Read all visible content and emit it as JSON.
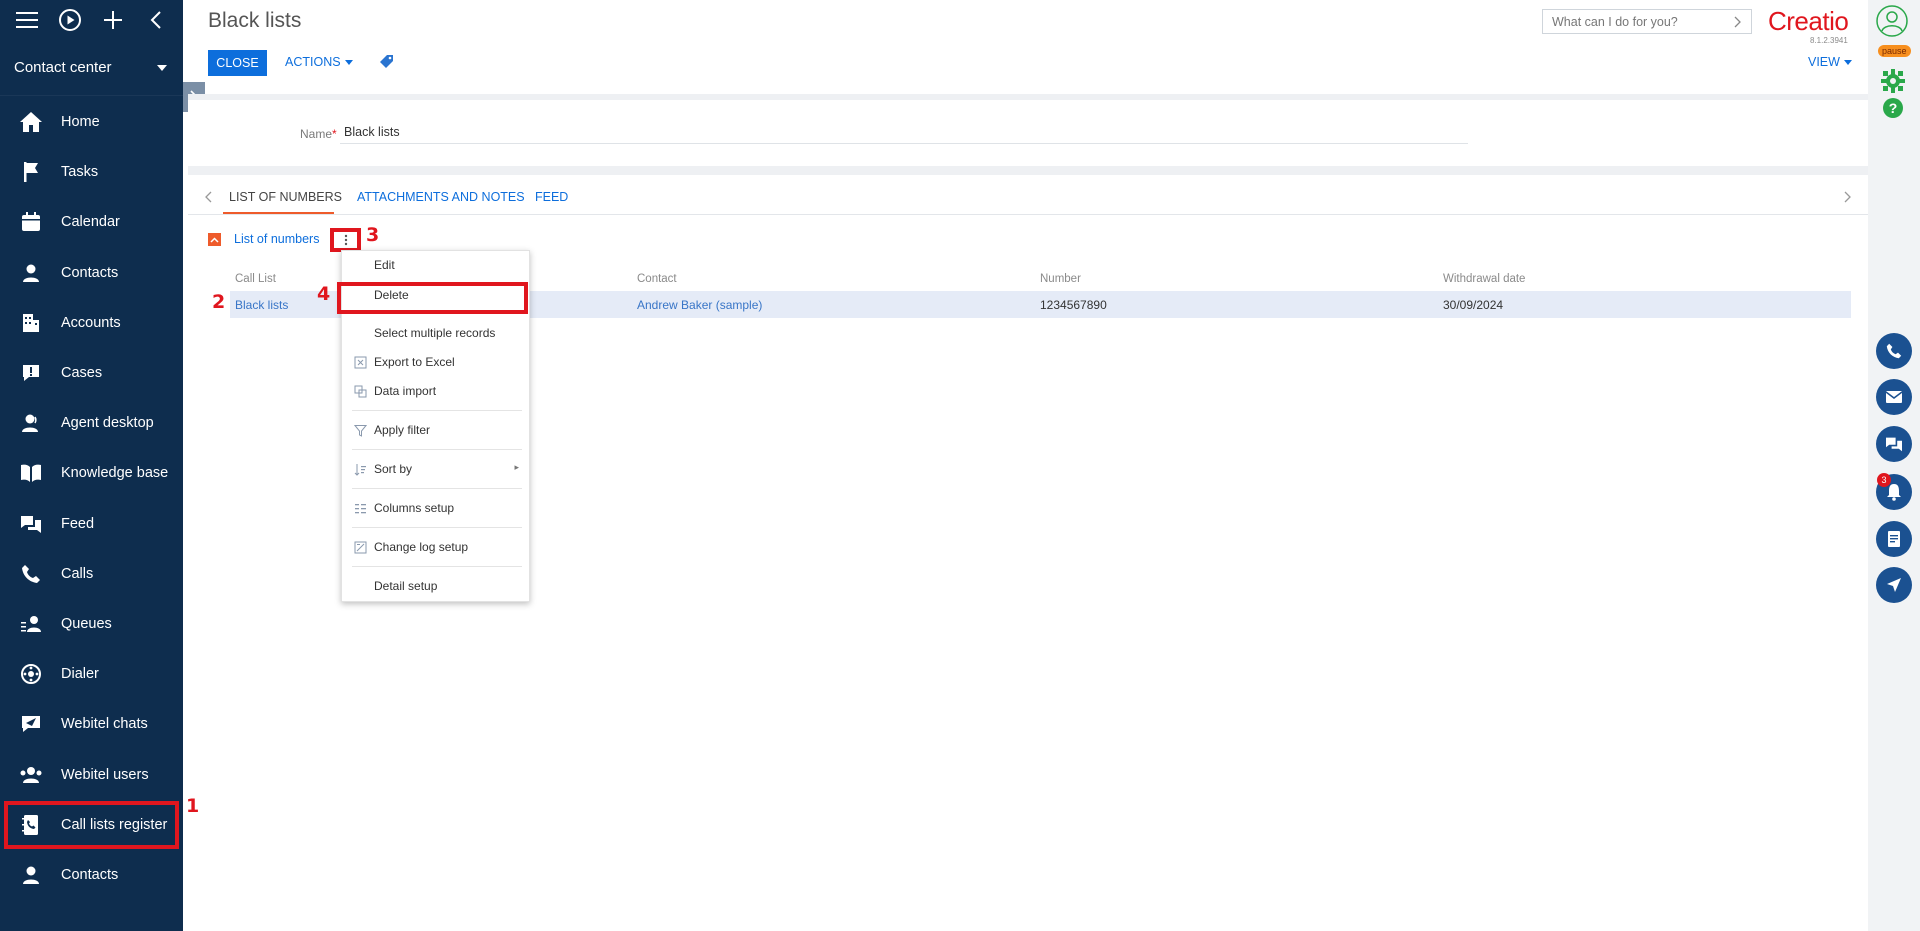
{
  "sidebar": {
    "workspace": "Contact center",
    "items": [
      {
        "label": "Home",
        "icon": "home-icon"
      },
      {
        "label": "Tasks",
        "icon": "flag-icon"
      },
      {
        "label": "Calendar",
        "icon": "calendar-icon"
      },
      {
        "label": "Contacts",
        "icon": "person-icon"
      },
      {
        "label": "Accounts",
        "icon": "building-icon"
      },
      {
        "label": "Cases",
        "icon": "alert-bubble-icon"
      },
      {
        "label": "Agent desktop",
        "icon": "agent-icon"
      },
      {
        "label": "Knowledge base",
        "icon": "book-icon"
      },
      {
        "label": "Feed",
        "icon": "chat-icon"
      },
      {
        "label": "Calls",
        "icon": "phone-icon"
      },
      {
        "label": "Queues",
        "icon": "queue-icon"
      },
      {
        "label": "Dialer",
        "icon": "dialer-icon"
      },
      {
        "label": "Webitel chats",
        "icon": "send-chat-icon"
      },
      {
        "label": "Webitel users",
        "icon": "users-icon"
      },
      {
        "label": "Call lists register",
        "icon": "call-list-icon"
      },
      {
        "label": "Contacts",
        "icon": "person-icon"
      }
    ]
  },
  "header": {
    "title": "Black lists",
    "close_label": "CLOSE",
    "actions_label": "ACTIONS",
    "view_label": "VIEW",
    "search_placeholder": "What can I do for you?",
    "logo": "Creatio",
    "version": "8.1.2.3941"
  },
  "record": {
    "name_label": "Name",
    "name_required_mark": "*",
    "name_value": "Black lists"
  },
  "tabs": [
    "LIST OF NUMBERS",
    "ATTACHMENTS AND NOTES",
    "FEED"
  ],
  "detail": {
    "title": "List of numbers",
    "columns": [
      "Call List",
      "Contact",
      "Number",
      "Withdrawal date"
    ],
    "rows": [
      {
        "call_list": "Black lists",
        "contact": "Andrew Baker (sample)",
        "number": "1234567890",
        "withdrawal_date": "30/09/2024"
      }
    ]
  },
  "menu": {
    "items": [
      "Edit",
      "Delete",
      "Select multiple records",
      "Export to Excel",
      "Data import",
      "Apply filter",
      "Sort by",
      "Columns setup",
      "Change log setup",
      "Detail setup"
    ]
  },
  "right_rail": {
    "pause_label": "pause",
    "notification_count": "3"
  },
  "annotations": [
    "1",
    "2",
    "3",
    "4"
  ],
  "colors": {
    "sidebar_bg": "#0e2d4e",
    "primary": "#0d6edc",
    "highlight": "#e0161e",
    "tab_accent": "#ee5b2b",
    "row_selected": "#e5ebf7"
  }
}
